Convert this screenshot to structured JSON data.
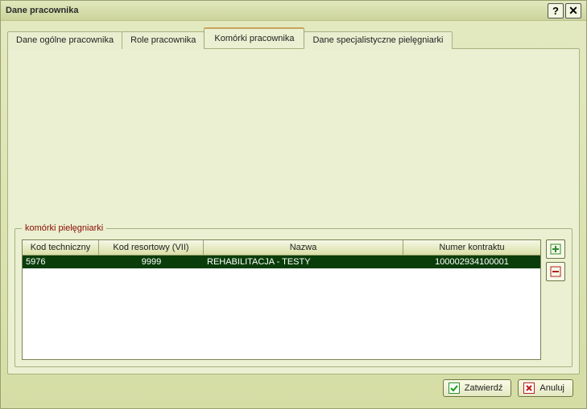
{
  "title": "Dane pracownika",
  "tabs": {
    "t0": "Dane ogólne pracownika",
    "t1": "Role pracownika",
    "t2": "Komórki pracownika",
    "t3": "Dane specjalistyczne pielęgniarki"
  },
  "fieldset_legend": "komórki pielęgniarki",
  "columns": {
    "c1": "Kod techniczny",
    "c2": "Kod resortowy (VII)",
    "c3": "Nazwa",
    "c4": "Numer kontraktu"
  },
  "rows": [
    {
      "c1": "5976",
      "c2": "9999",
      "c3": "REHABILITACJA - TESTY",
      "c4": "100002934100001"
    }
  ],
  "buttons": {
    "confirm": "Zatwierdź",
    "cancel": "Anuluj"
  }
}
